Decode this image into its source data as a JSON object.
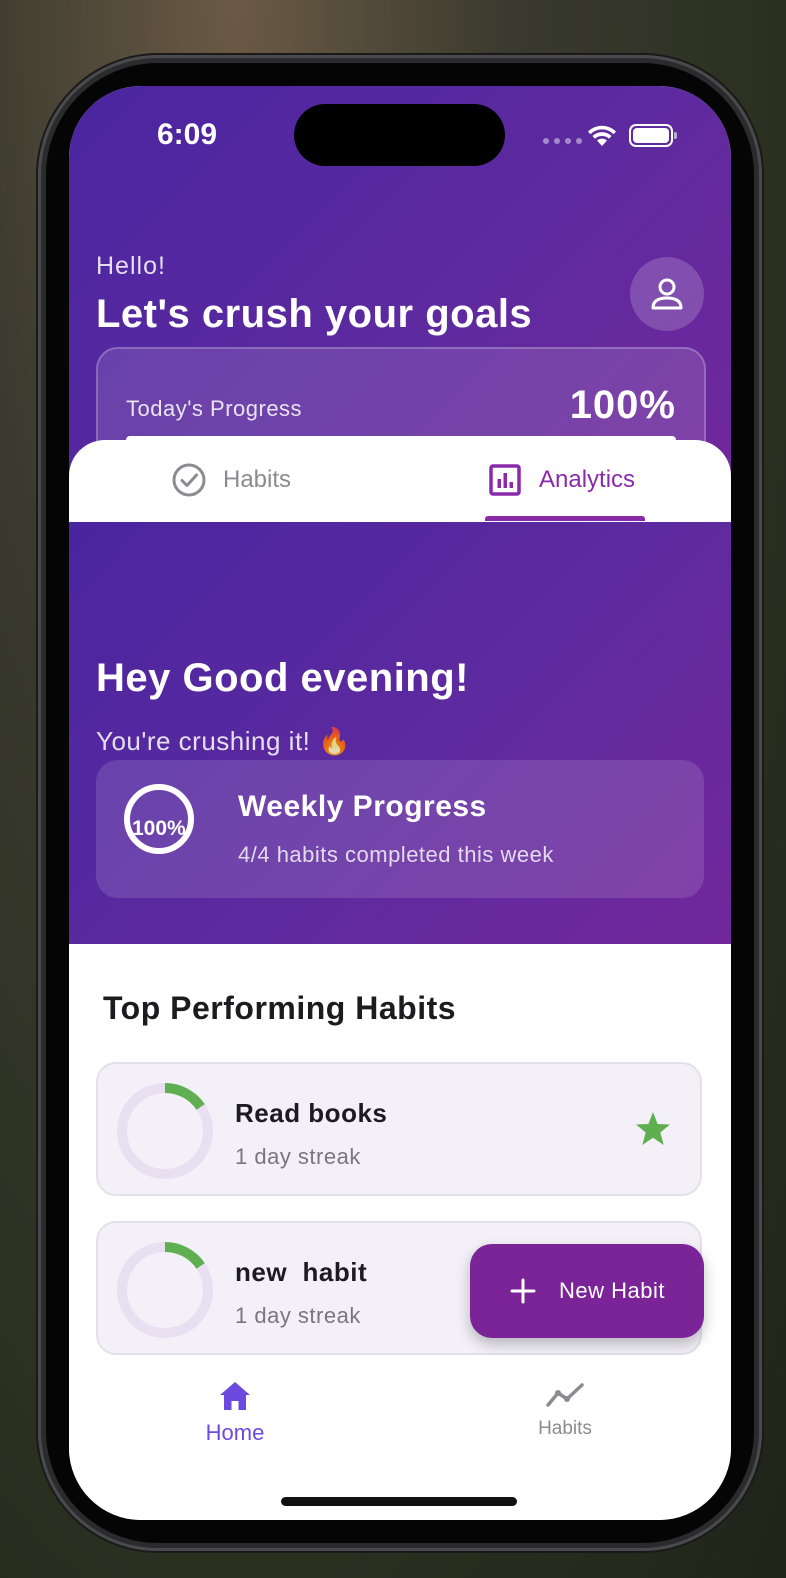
{
  "status_bar": {
    "time": "6:09"
  },
  "header": {
    "greeting": "Hello!",
    "headline": "Let's crush your goals",
    "progress_label": "Today's Progress",
    "progress_value": "100%",
    "progress_fraction": 1.0
  },
  "tabs": [
    {
      "label": "Habits",
      "icon": "check-circle-icon",
      "selected": false
    },
    {
      "label": "Analytics",
      "icon": "bar-chart-icon",
      "selected": true
    }
  ],
  "analytics": {
    "title": "Hey Good evening!",
    "subtitle": "You're crushing it! 🔥",
    "weekly": {
      "percent_label": "100%",
      "title": "Weekly Progress",
      "subtitle": "4/4 habits completed this week"
    }
  },
  "top_habits": {
    "title": "Top Performing Habits",
    "items": [
      {
        "name": "Read books",
        "streak": "1 day streak",
        "icon": "star-icon"
      },
      {
        "name": "new  habit",
        "streak": "1 day streak"
      }
    ]
  },
  "fab": {
    "label": "New Habit",
    "icon": "plus-icon"
  },
  "bottom_nav": [
    {
      "label": "Home",
      "icon": "home-icon",
      "selected": true
    },
    {
      "label": "Habits",
      "icon": "trend-line-icon",
      "selected": false
    }
  ],
  "colors": {
    "primary_purple": "#7a2497",
    "accent_purple": "#8b2aa8",
    "nav_selected": "#6c4ae0",
    "streak_green": "#5fae4f"
  }
}
